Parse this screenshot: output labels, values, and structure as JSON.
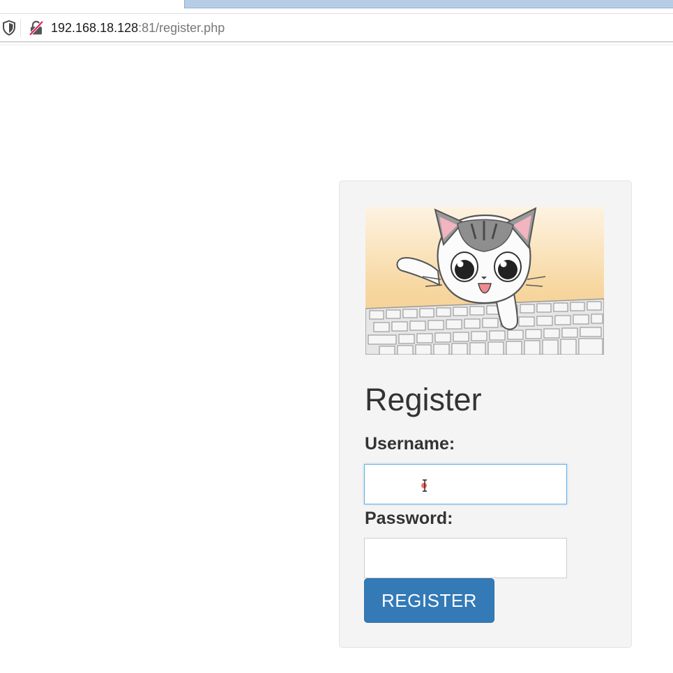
{
  "browser": {
    "url_host": "192.168.18.128",
    "url_rest": ":81/register.php"
  },
  "register": {
    "title": "Register",
    "username_label": "Username:",
    "username_value": "",
    "password_label": "Password:",
    "password_value": "",
    "submit_label": "REGISTER"
  },
  "icons": {
    "site_security": "shield-icon",
    "connection": "insecure-lock-icon",
    "pointer": "text-cursor-icon"
  },
  "colors": {
    "button": "#337ab7",
    "card": "#f4f4f4",
    "focus": "#66afe9"
  }
}
